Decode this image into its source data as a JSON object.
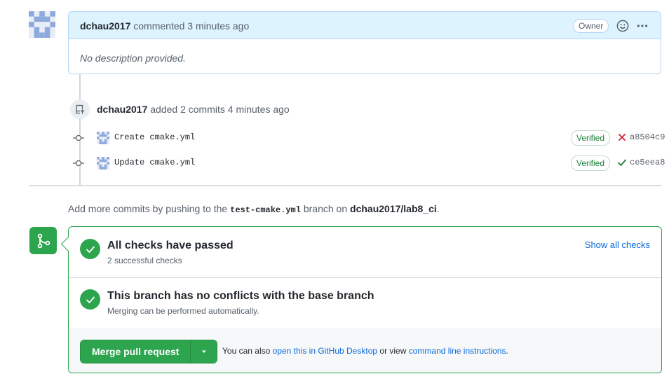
{
  "comment": {
    "author": "dchau2017",
    "action": "commented 3 minutes ago",
    "badge": "Owner",
    "body": "No description provided."
  },
  "commits_event": {
    "author": "dchau2017",
    "action": "added 2 commits 4 minutes ago",
    "commits": [
      {
        "message": "Create cmake.yml",
        "verified": "Verified",
        "status": "failure",
        "sha": "a8504c9"
      },
      {
        "message": "Update cmake.yml",
        "verified": "Verified",
        "status": "success",
        "sha": "ce5eea8"
      }
    ]
  },
  "push_hint": {
    "prefix": "Add more commits by pushing to the",
    "branch": "test-cmake.yml",
    "middle": "branch on",
    "repo": "dchau2017/lab8_ci",
    "suffix": "."
  },
  "merge_box": {
    "checks_title": "All checks have passed",
    "checks_sub": "2 successful checks",
    "show_all": "Show all checks",
    "conflicts_title": "This branch has no conflicts with the base branch",
    "conflicts_sub": "Merging can be performed automatically.",
    "merge_button": "Merge pull request",
    "also_prefix": "You can also",
    "desktop_link": "open this in GitHub Desktop",
    "or_view": "or view",
    "cli_link": "command line instructions",
    "also_suffix": "."
  },
  "colors": {
    "success": "#2da44e",
    "danger": "#cf222e",
    "link": "#0969da",
    "comment_header": "#ddf4ff"
  },
  "icons": [
    "avatar-identicon",
    "smiley-icon",
    "kebab-icon",
    "repo-push-icon",
    "git-commit-icon",
    "x-icon",
    "check-icon",
    "git-merge-icon",
    "triangle-down-icon"
  ]
}
